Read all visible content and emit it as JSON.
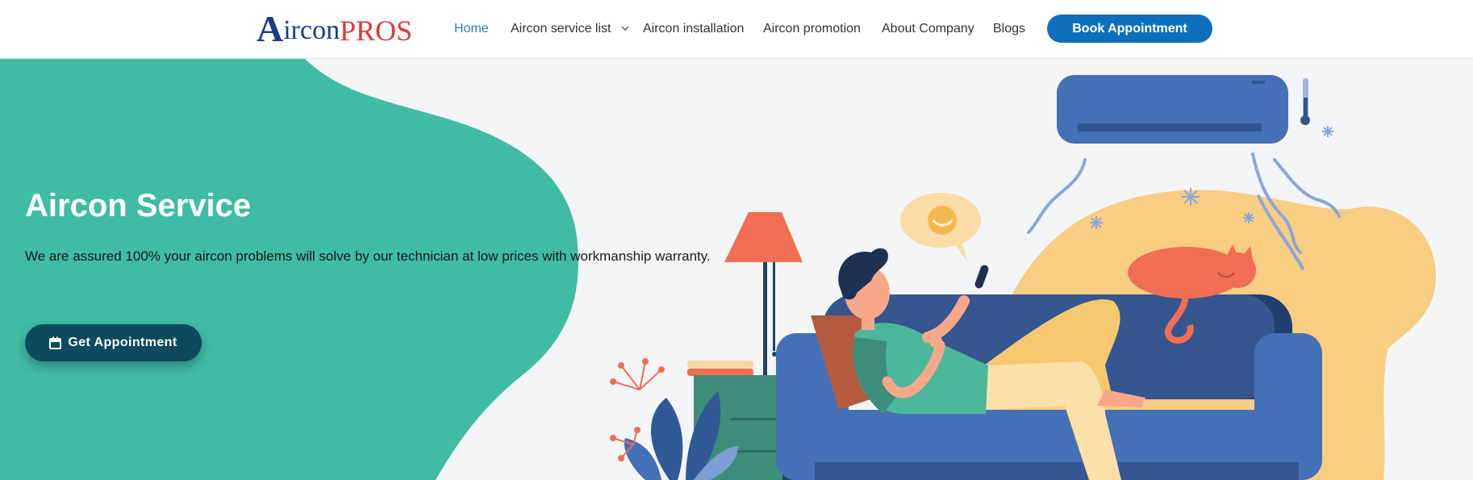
{
  "header": {
    "logo": {
      "a": "A",
      "ircon": "ircon",
      "pros": "PROS"
    },
    "nav": [
      {
        "label": "Home",
        "active": true
      },
      {
        "label": "Aircon service list",
        "dropdown": true
      },
      {
        "label": "Aircon installation"
      },
      {
        "label": "Aircon promotion"
      },
      {
        "label": "About Company"
      },
      {
        "label": "Blogs"
      }
    ],
    "book_button": "Book Appointment"
  },
  "hero": {
    "title": "Aircon Service",
    "text": "We are assured 100% your aircon problems will solve by our technician at low prices with workmanship warranty.",
    "button": "Get Appointment",
    "button_icon": "calendar-icon"
  },
  "colors": {
    "accent_blue": "#0f6fbf",
    "nav_active": "#2b7fc0",
    "teal": "#40bca5",
    "dark_button": "#0c4a5c",
    "logo_blue": "#1b3d87",
    "logo_red": "#e0383b"
  }
}
